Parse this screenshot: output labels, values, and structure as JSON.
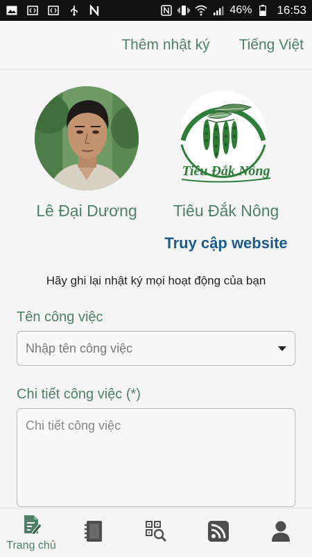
{
  "status_bar": {
    "battery": "46%",
    "time": "16:53",
    "left_icons": [
      "image-icon",
      "code-icon",
      "code-icon",
      "usb-icon",
      "n-icon"
    ],
    "right_icons": [
      "nfc-icon",
      "vibrate-icon",
      "wifi-icon",
      "signal-icon",
      "battery-icon"
    ]
  },
  "header": {
    "add_diary_label": "Thêm nhật ký",
    "language_label": "Tiếng Việt"
  },
  "profile": {
    "user_name": "Lê Đại Dương",
    "brand_name": "Tiêu Đắk Nông",
    "brand_logo_text": "Tiêu Đắk Nông",
    "website_link": "Truy cập website"
  },
  "intro_text": "Hãy ghi lại nhật ký mọi hoạt động của bạn",
  "form": {
    "job_name_label": "Tên công việc",
    "job_name_placeholder": "Nhập tên công việc",
    "job_detail_label": "Chi tiết công việc (*)",
    "job_detail_placeholder": "Chi tiết công việc"
  },
  "bottom_nav": {
    "items": [
      {
        "label": "Trang chủ",
        "icon": "home-diary-icon",
        "active": true
      },
      {
        "label": "",
        "icon": "notebook-icon"
      },
      {
        "label": "",
        "icon": "qr-search-icon"
      },
      {
        "label": "",
        "icon": "rss-icon"
      },
      {
        "label": "",
        "icon": "user-icon"
      }
    ]
  },
  "colors": {
    "accent_green": "#4f7f67",
    "link_blue": "#1a5a8c",
    "status_bar": "#111111"
  }
}
